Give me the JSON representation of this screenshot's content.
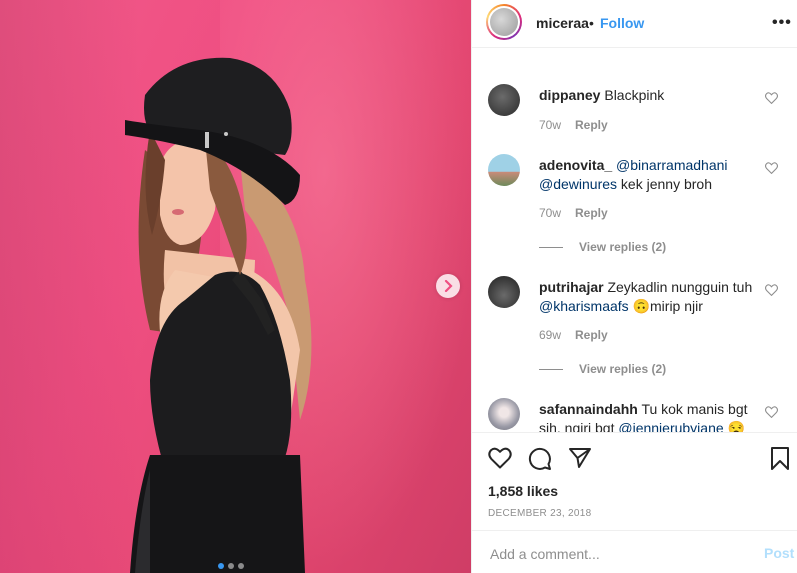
{
  "post": {
    "username": "miceraa",
    "bullet": "•",
    "follow_label": "Follow",
    "more_label": "•••",
    "photo_pages": 3,
    "photo_active_page": 1
  },
  "comments": [
    {
      "user": "dippaney",
      "text": "Blackpink",
      "time": "70w",
      "reply_label": "Reply",
      "avatar_color": "#3a3a3a"
    },
    {
      "user": "adenovita_",
      "mention1": "@binarramadhani",
      "mention2": "@dewinures",
      "text": "kek jenny broh",
      "time": "70w",
      "reply_label": "Reply",
      "view_replies": "View replies (2)",
      "avatar_color": "#8fc3d8"
    },
    {
      "user": "putrihajar",
      "text1": "Zeykadlin nungguin tuh",
      "mention": "@kharismaafs",
      "emoji": "🙃",
      "text2": "mirip njir",
      "time": "69w",
      "reply_label": "Reply",
      "view_replies": "View replies (2)",
      "avatar_color": "#2d2d2d"
    },
    {
      "user": "safannaindahh",
      "text": "Tu kok manis bgt sih, ngiri bgt",
      "mention": "@jennierubyjane",
      "emoji": "😒",
      "avatar_color": "#b8b8c0"
    }
  ],
  "actions": {
    "likes": "1,858 likes",
    "date": "DECEMBER 23, 2018"
  },
  "add_comment": {
    "placeholder": "Add a comment...",
    "post_label": "Post"
  },
  "colors": {
    "link_blue": "#3897f0",
    "mention_blue": "#003569",
    "muted_gray": "#8e8e8e",
    "background_pink": "#ef4f82"
  }
}
